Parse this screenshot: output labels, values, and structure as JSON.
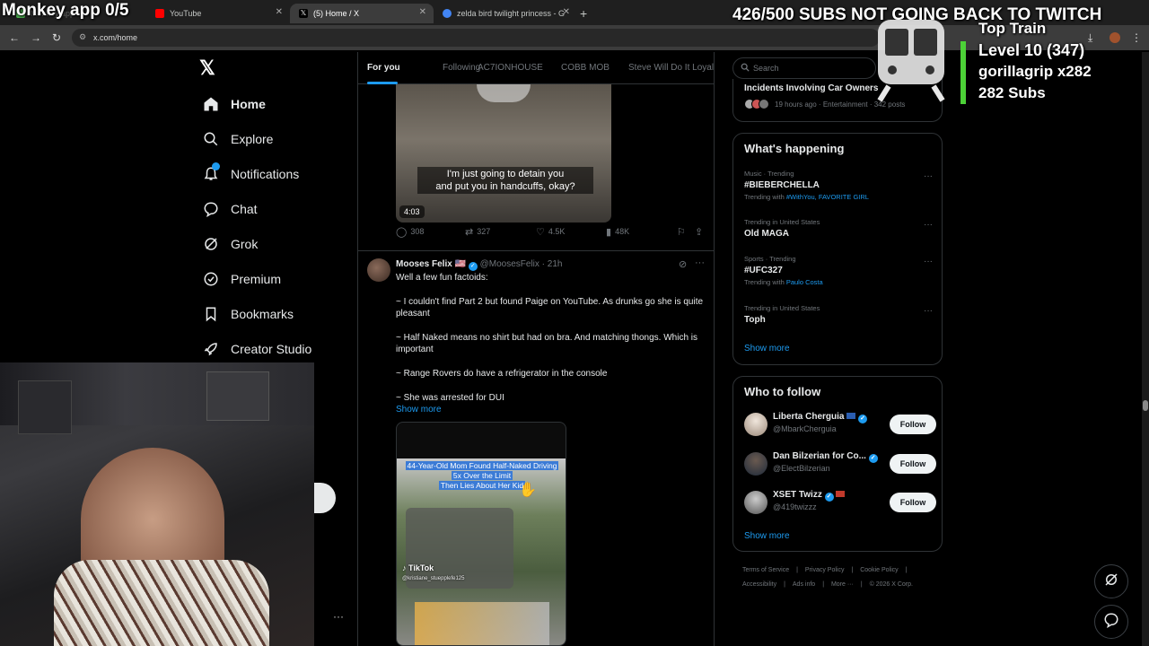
{
  "browser": {
    "tabs": [
      {
        "label": "Monkey app",
        "active": false
      },
      {
        "label": "YouTube",
        "active": false
      },
      {
        "label": "(5) Home / X",
        "active": true
      },
      {
        "label": "zelda bird twilight princess - G",
        "active": false
      }
    ],
    "url": "x.com/home"
  },
  "overlay": {
    "left_text": "Monkey app 0/5",
    "right_text": "426/500 SUBS NOT GOING BACK TO TWITCH",
    "train": {
      "title": "Top Train",
      "level": "Level 10  (347)",
      "user": "gorillagrip x282",
      "subs": "282 Subs"
    }
  },
  "nav": {
    "items": [
      {
        "label": "Home",
        "icon": "home-icon"
      },
      {
        "label": "Explore",
        "icon": "search-icon"
      },
      {
        "label": "Notifications",
        "icon": "bell-icon"
      },
      {
        "label": "Chat",
        "icon": "chat-icon"
      },
      {
        "label": "Grok",
        "icon": "grok-icon"
      },
      {
        "label": "Premium",
        "icon": "premium-icon"
      },
      {
        "label": "Bookmarks",
        "icon": "bookmark-icon"
      },
      {
        "label": "Creator Studio",
        "icon": "rocket-icon"
      }
    ]
  },
  "feed": {
    "tabs": [
      "For you",
      "Following",
      "AC7IONHOUSE",
      "COBB MOB",
      "Steve Will Do It Loyal"
    ],
    "post1": {
      "caption_line1": "I'm just going to detain you",
      "caption_line2": "and  put you in handcuffs, okay?",
      "duration": "4:03",
      "replies": "308",
      "reposts": "327",
      "likes": "4.5K",
      "views": "48K"
    },
    "post2": {
      "name": "Mooses Felix",
      "flag": "🇺🇸",
      "handle": "@MoosesFelix · 21h",
      "lines": [
        "Well a few fun factoids:",
        "~ I couldn't find Part 2 but found Paige on YouTube. As drunks go she is quite pleasant",
        "~ Half Naked means no shirt but had on bra. And matching thongs. Which is important",
        "~ Range Rovers do have a refrigerator in the console",
        "~ She was arrested for DUI"
      ],
      "show_more": "Show more",
      "video_headline_1": "44-Year-Old Mom Found Half-Naked Driving",
      "video_headline_2": "5x Over the Limit",
      "video_headline_3": "Then Lies About Her Kid",
      "video_tiktok": "TikTok",
      "video_handle": "@kristiane_stuepplefe125"
    }
  },
  "right": {
    "search_placeholder": "Search",
    "incident": {
      "title": "Incidents Involving Car Owners",
      "meta": "19 hours ago · Entertainment · 342 posts"
    },
    "whats_happening": {
      "title": "What's happening",
      "trends": [
        {
          "category": "Music · Trending",
          "name": "#BIEBERCHELLA",
          "with_label": "Trending with ",
          "with": "#WithYou, FAVORITE GIRL"
        },
        {
          "category": "Trending in United States",
          "name": "Old MAGA",
          "with_label": "",
          "with": ""
        },
        {
          "category": "Sports · Trending",
          "name": "#UFC327",
          "with_label": "Trending with ",
          "with": "Paulo Costa"
        },
        {
          "category": "Trending in United States",
          "name": "Toph",
          "with_label": "",
          "with": ""
        }
      ],
      "show_more": "Show more"
    },
    "who_to_follow": {
      "title": "Who to follow",
      "users": [
        {
          "name": "Liberta Cherguia",
          "handle": "@MbarkCherguia",
          "button": "Follow"
        },
        {
          "name": "Dan Bilzerian for Co...",
          "handle": "@ElectBilzerian",
          "button": "Follow"
        },
        {
          "name": "XSET Twizz",
          "handle": "@419twizzz",
          "button": "Follow"
        }
      ],
      "show_more": "Show more"
    },
    "footer": {
      "links": [
        "Terms of Service",
        "Privacy Policy",
        "Cookie Policy",
        "Accessibility",
        "Ads info",
        "More ···",
        "© 2026 X Corp."
      ]
    }
  },
  "colors": {
    "accent": "#1d9bf0",
    "background": "#000000",
    "border": "#2f3336"
  }
}
